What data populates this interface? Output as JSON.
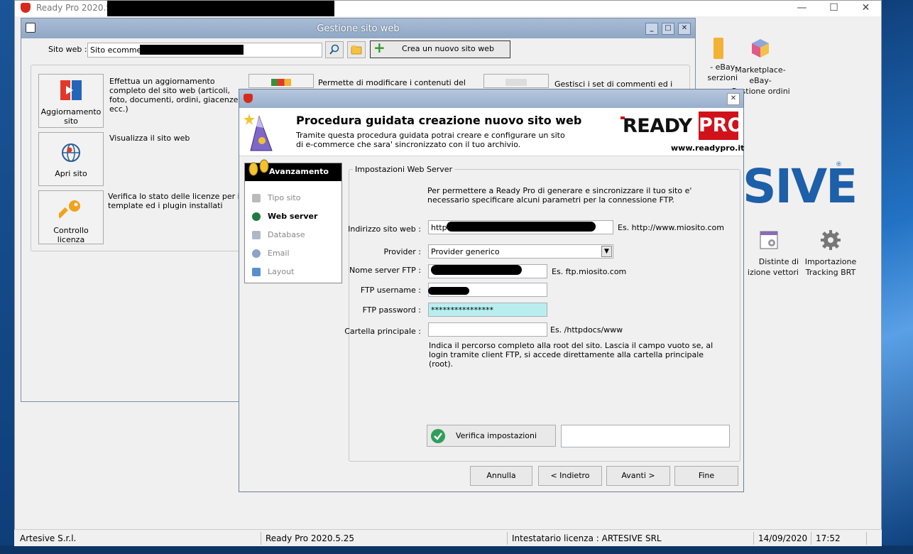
{
  "app": {
    "title": "Ready Pro 2020.5.25",
    "window_controls": {
      "minimize": "—",
      "maximize": "☐",
      "close": "✕"
    }
  },
  "right_icons": [
    {
      "label_line1": "- eBay-",
      "label_line2": "serzioni"
    },
    {
      "label_line1": "Marketplace- eBay-",
      "label_line2": "Gestione ordini"
    },
    {
      "label_line1": "Distinte di",
      "label_line2": "izione vettori"
    },
    {
      "label_line1": "Importazione",
      "label_line2": "Tracking BRT"
    }
  ],
  "artesive_logo": "SIVE",
  "statusbar": {
    "company": "Artesive S.r.l.",
    "version": "Ready Pro 2020.5.25",
    "license": "Intestatario licenza : ARTESIVE SRL",
    "date": "14/09/2020",
    "time": "17:52"
  },
  "gsw": {
    "title": "Gestione sito web",
    "site_label": "Sito web :",
    "site_value": "Sito ecommerce",
    "new_site_button": "Crea un nuovo sito web",
    "actions": [
      {
        "label": "Aggiornamento sito",
        "desc": "Effettua un aggiornamento completo del sito web (articoli, foto, documenti, ordini, giacenze, ecc.)"
      },
      {
        "label": "Apri sito",
        "desc": "Visualizza il sito web"
      },
      {
        "label": "Controllo licenza",
        "desc": "Verifica lo stato delle licenze per il template ed i plugin installati"
      }
    ],
    "partial_desc_1": "Permette di modificare i contenuti del",
    "partial_desc_2": "Gestisci i set di commenti ed i"
  },
  "wizard": {
    "title": "Procedura guidata creazione nuovo sito web",
    "subtitle": "Tramite questa procedura guidata potrai creare e configurare un sito di e-commerce che sara' sincronizzato con il tuo archivio.",
    "logo_ready": "READY",
    "logo_pro": "PRO",
    "logo_url": "www.readypro.it",
    "progress_header": "Avanzamento",
    "steps": [
      {
        "label": "Tipo sito",
        "active": false
      },
      {
        "label": "Web server",
        "active": true
      },
      {
        "label": "Database",
        "active": false
      },
      {
        "label": "Email",
        "active": false
      },
      {
        "label": "Layout",
        "active": false
      }
    ],
    "group_title": "Impostazioni Web Server",
    "intro": "Per permettere a Ready Pro di generare e sincronizzare il tuo sito e' necessario specificare alcuni parametri per la connessione FTP.",
    "fields": {
      "site_address_label": "Indirizzo sito web :",
      "site_address_value": "http:",
      "site_address_hint": "Es. http://www.miosito.com",
      "provider_label": "Provider :",
      "provider_value": "Provider generico",
      "ftp_server_label": "Nome server FTP :",
      "ftp_server_hint": "Es. ftp.miosito.com",
      "ftp_user_label": "FTP username :",
      "ftp_password_label": "FTP password :",
      "ftp_password_value": "****************",
      "root_folder_label": "Cartella principale :",
      "root_folder_value": "",
      "root_folder_hint": "Es. /httpdocs/www",
      "root_folder_note": "Indica il percorso completo alla root del sito. Lascia il campo vuoto se, al login tramite client FTP, si accede direttamente alla cartella principale (root)."
    },
    "verify_button": "Verifica impostazioni",
    "verify_result": "",
    "buttons": {
      "cancel": "Annulla",
      "back": "< Indietro",
      "next": "Avanti >",
      "finish": "Fine"
    }
  }
}
